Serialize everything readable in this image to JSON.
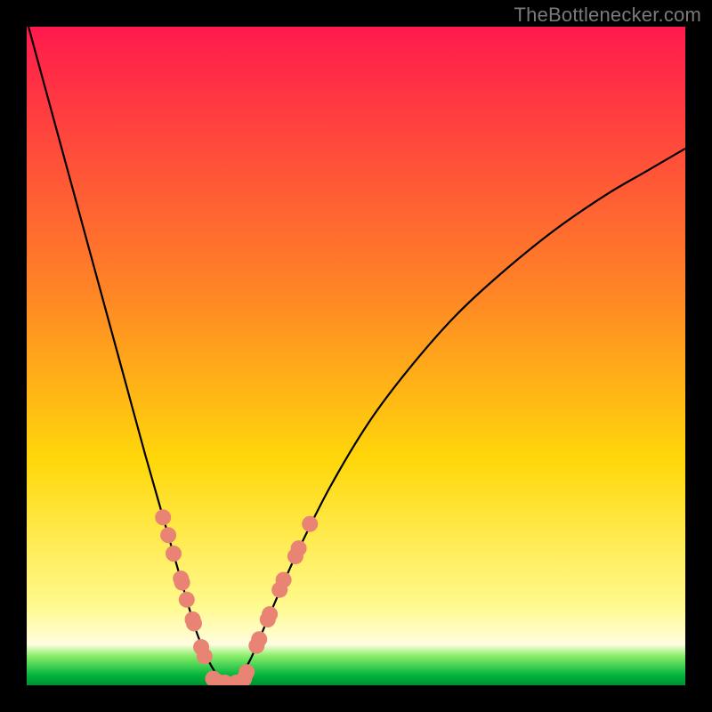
{
  "watermark": "TheBottlenecker.com",
  "chart_data": {
    "type": "line",
    "title": "",
    "xlabel": "",
    "ylabel": "",
    "xlim": [
      0,
      1
    ],
    "ylim": [
      0,
      1
    ],
    "series": [
      {
        "name": "curve",
        "x": [
          0.0,
          0.03,
          0.06,
          0.09,
          0.12,
          0.15,
          0.18,
          0.21,
          0.24,
          0.26,
          0.28,
          0.3,
          0.32,
          0.34,
          0.37,
          0.41,
          0.46,
          0.52,
          0.58,
          0.65,
          0.72,
          0.8,
          0.88,
          0.94,
          1.0
        ],
        "y": [
          1.01,
          0.9,
          0.79,
          0.68,
          0.57,
          0.46,
          0.35,
          0.245,
          0.14,
          0.075,
          0.03,
          0.005,
          0.01,
          0.04,
          0.11,
          0.2,
          0.3,
          0.4,
          0.48,
          0.56,
          0.625,
          0.69,
          0.745,
          0.78,
          0.815
        ]
      }
    ],
    "points": {
      "name": "dots",
      "x": [
        0.207,
        0.215,
        0.223,
        0.234,
        0.236,
        0.243,
        0.252,
        0.254,
        0.265,
        0.27,
        0.283,
        0.289,
        0.301,
        0.318,
        0.33,
        0.334,
        0.349,
        0.353,
        0.366,
        0.369,
        0.384,
        0.39,
        0.408,
        0.413,
        0.43
      ],
      "y": [
        0.255,
        0.228,
        0.2,
        0.162,
        0.156,
        0.13,
        0.1,
        0.094,
        0.058,
        0.044,
        0.01,
        0.006,
        0.004,
        0.004,
        0.01,
        0.02,
        0.06,
        0.07,
        0.1,
        0.108,
        0.145,
        0.16,
        0.196,
        0.208,
        0.245
      ]
    },
    "background_gradient": {
      "stops": [
        {
          "pos": 0.0,
          "color": "#ff1a4d"
        },
        {
          "pos": 0.4,
          "color": "#ff8426"
        },
        {
          "pos": 0.66,
          "color": "#ffd80a"
        },
        {
          "pos": 0.88,
          "color": "#fffa8e"
        },
        {
          "pos": 0.938,
          "color": "#fffde0"
        },
        {
          "pos": 0.955,
          "color": "#8cef6a"
        },
        {
          "pos": 0.985,
          "color": "#00b43c"
        },
        {
          "pos": 1.0,
          "color": "#009030"
        }
      ]
    }
  }
}
